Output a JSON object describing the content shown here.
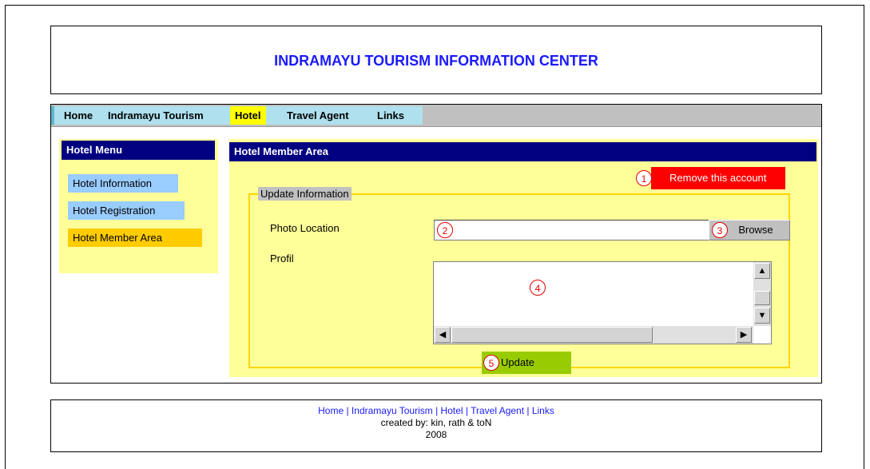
{
  "header": {
    "title": "INDRAMAYU TOURISM INFORMATION CENTER"
  },
  "nav": {
    "items": [
      {
        "label": "Home"
      },
      {
        "label": "Indramayu Tourism"
      },
      {
        "label": "Hotel"
      },
      {
        "label": "Travel Agent"
      },
      {
        "label": "Links"
      }
    ],
    "active": "Hotel",
    "active_color": "#ffff00"
  },
  "sidebar": {
    "title": "Hotel Menu",
    "items": [
      {
        "label": "Hotel Information",
        "color": "#99ccff"
      },
      {
        "label": "Hotel Registration",
        "color": "#99ccff"
      },
      {
        "label": "Hotel Member Area",
        "color": "#ffcc00"
      }
    ]
  },
  "content": {
    "title": "Hotel Member Area",
    "remove_button": {
      "label": "Remove this account",
      "number": "1",
      "color": "#ff0000"
    },
    "fieldset": {
      "legend": "Update Information",
      "photo_label": "Photo Location",
      "photo_value": "",
      "photo_number": "2",
      "browse_label": "Browse",
      "browse_number": "3",
      "profil_label": "Profil",
      "profil_value": "",
      "profil_number": "4",
      "update_label": "Update",
      "update_number": "5",
      "update_color": "#99cc00"
    }
  },
  "footer": {
    "links": "Home | Indramayu Tourism | Hotel | Travel Agent | Links",
    "credit": "created by: kin, rath & toN",
    "year": "2008"
  },
  "colors": {
    "title_blue": "#1a1aff",
    "panel_yellow": "#ffff99",
    "bar_navy": "#000080",
    "fieldset_border": "#ffd500"
  }
}
